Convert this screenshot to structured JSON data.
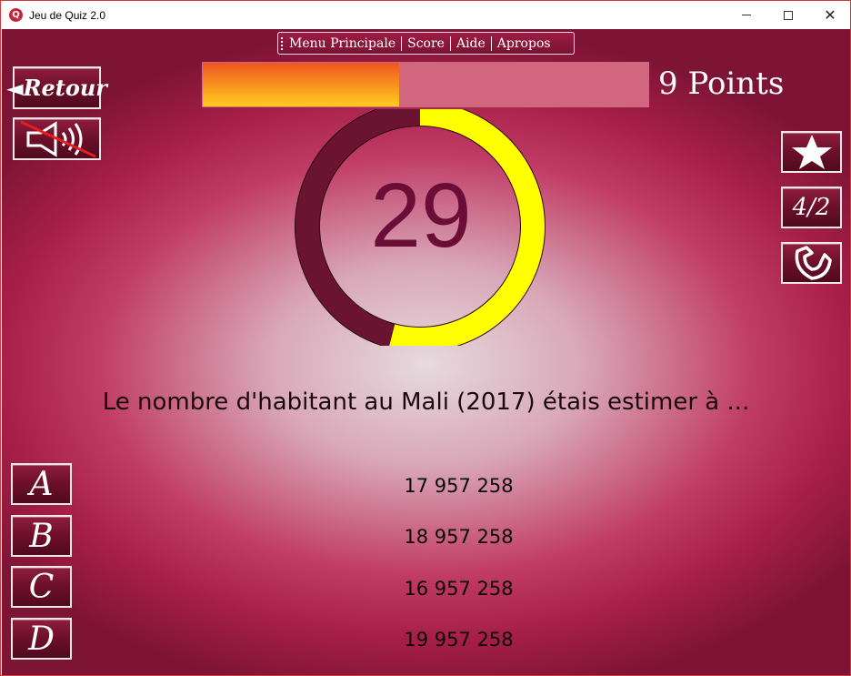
{
  "window": {
    "title": "Jeu de Quiz 2.0",
    "app_icon_letter": "Q"
  },
  "menu": {
    "items": [
      "Menu Principale",
      "Score",
      "Aide",
      "Apropos"
    ]
  },
  "toolbar": {
    "back_label": "◄Retour",
    "sound_icon": "speaker-muted-icon"
  },
  "lifelines": {
    "star_icon": "star-icon",
    "fifty_label": "4/2",
    "phone_icon": "phone-handset-icon"
  },
  "score": {
    "progress_fraction": 0.44,
    "points_label": "9 Points"
  },
  "timer": {
    "seconds": "29",
    "remaining_fraction": 0.54,
    "ring_color": "#ffff00",
    "track_color": "#6a1431"
  },
  "question": {
    "text": "Le nombre d'habitant au Mali (2017) étais estimer à ..."
  },
  "answers": [
    {
      "letter": "A",
      "value": "17 957 258"
    },
    {
      "letter": "B",
      "value": "18 957 258"
    },
    {
      "letter": "C",
      "value": "16 957 258"
    },
    {
      "letter": "D",
      "value": "19 957 258"
    }
  ],
  "colors": {
    "accent": "#a51e48",
    "progress_start": "#f05522",
    "progress_end": "#ffcd1c",
    "timer_number": "#6a0e38"
  }
}
